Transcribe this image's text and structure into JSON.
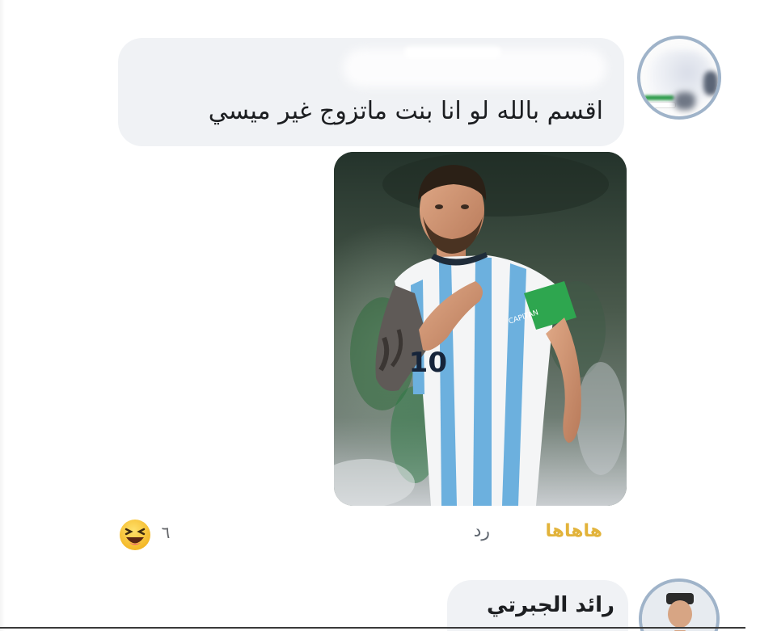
{
  "comment": {
    "author_name_redacted": true,
    "text": "اقسم بالله لو انا بنت ماتزوج غير ميسي",
    "photo_icon": "footballer-photo",
    "jersey_number": "10"
  },
  "actions": {
    "laugh_label": "هاهاها",
    "reply_label": "رد"
  },
  "reactions": {
    "count": "٦",
    "emoji_icon": "laughing-face-icon"
  },
  "reply_comment": {
    "author_name": "رائد الجبرتي"
  },
  "colors": {
    "bubble": "#f0f2f5",
    "laugh_accent": "#e2b33a",
    "muted_text": "#606770",
    "avatar_ring": "#9fb3c9",
    "jersey_blue": "#6cb0de"
  }
}
